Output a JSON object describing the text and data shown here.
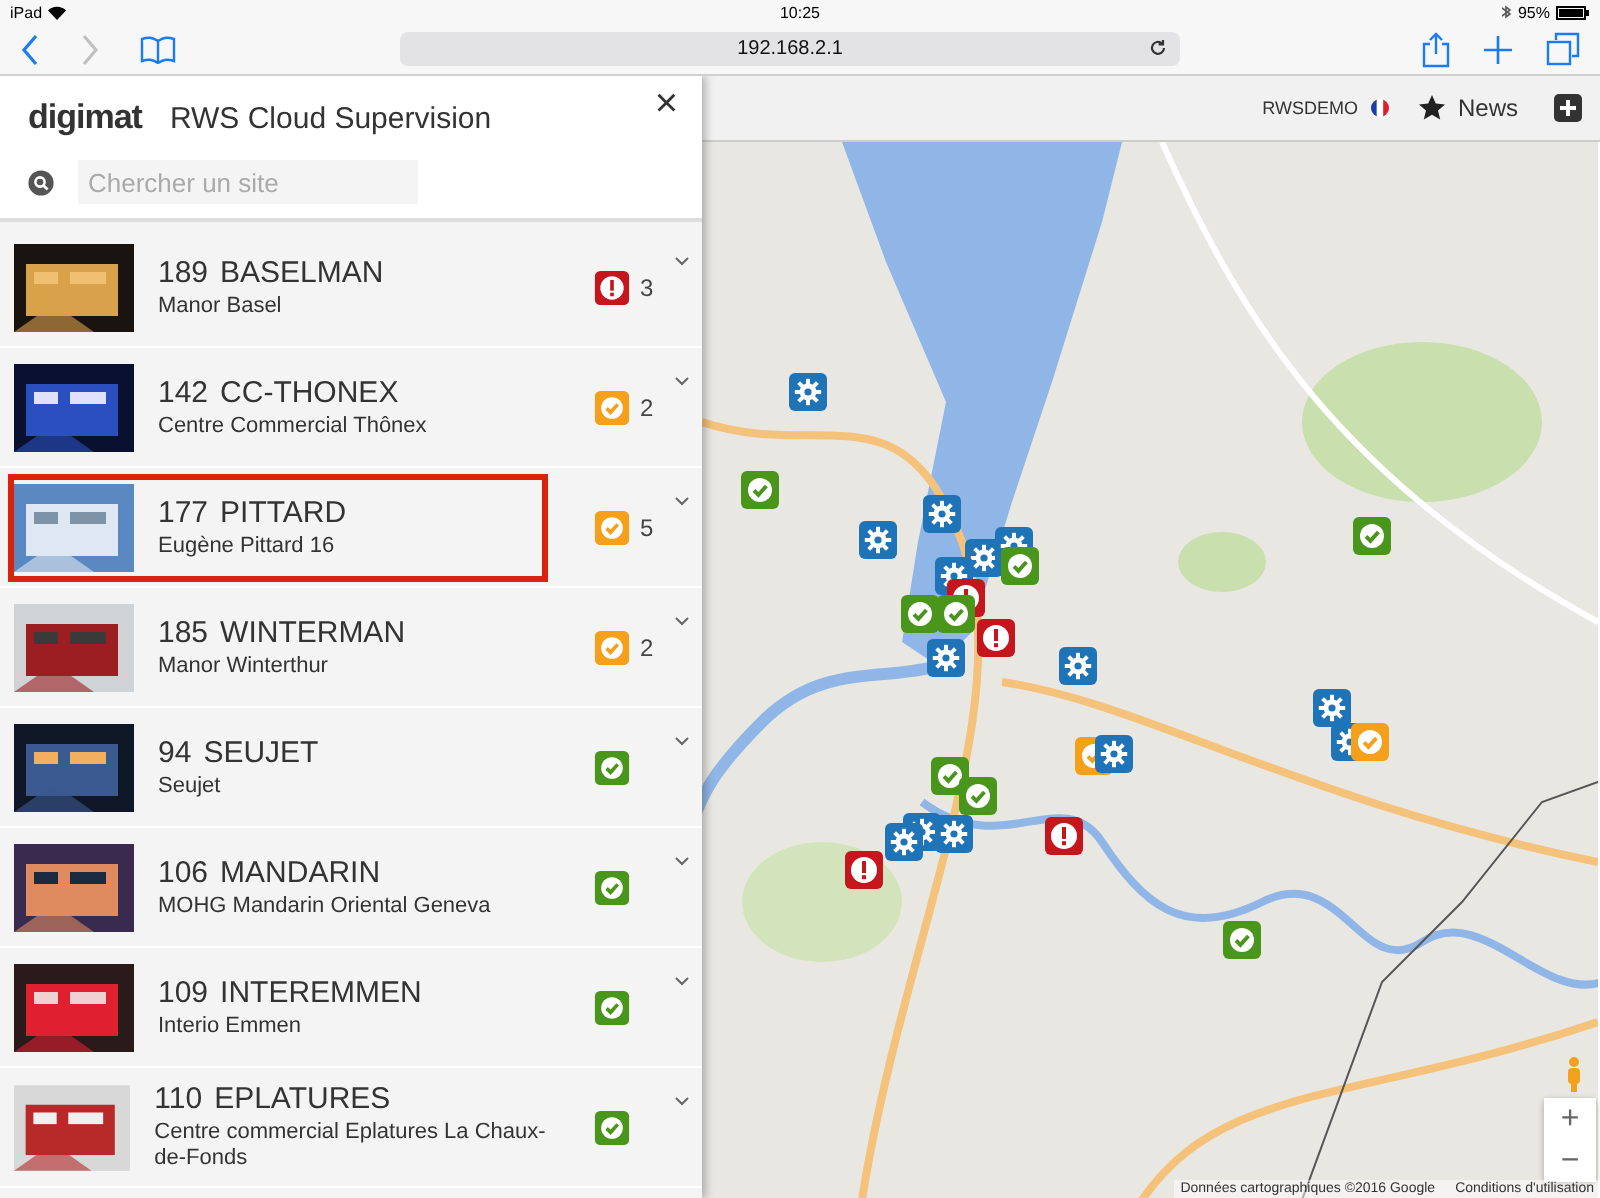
{
  "status_bar": {
    "device": "iPad",
    "time": "10:25",
    "battery": "95%"
  },
  "browser": {
    "address": "192.168.2.1"
  },
  "sidebar": {
    "logo": "digimat",
    "title": "RWS Cloud Supervision",
    "close": "×",
    "search": {
      "placeholder": "Chercher un site"
    },
    "sites": [
      {
        "number": "189",
        "name": "BASELMAN",
        "subtitle": "Manor Basel",
        "kind": "alarm",
        "count": "3",
        "selected": false
      },
      {
        "number": "142",
        "name": "CC-THONEX",
        "subtitle": "Centre Commercial Thônex",
        "kind": "warning",
        "count": "2",
        "selected": false
      },
      {
        "number": "177",
        "name": "PITTARD",
        "subtitle": "Eugène Pittard 16",
        "kind": "warning",
        "count": "5",
        "selected": true
      },
      {
        "number": "185",
        "name": "WINTERMAN",
        "subtitle": "Manor Winterthur",
        "kind": "warning",
        "count": "2",
        "selected": false
      },
      {
        "number": "94",
        "name": "SEUJET",
        "subtitle": "Seujet",
        "kind": "ok",
        "selected": false
      },
      {
        "number": "106",
        "name": "MANDARIN",
        "subtitle": "MOHG Mandarin Oriental Geneva",
        "kind": "ok",
        "selected": false
      },
      {
        "number": "109",
        "name": "INTEREMMEN",
        "subtitle": "Interio Emmen",
        "kind": "ok",
        "selected": false
      },
      {
        "number": "110",
        "name": "EPLATURES",
        "subtitle": "Centre commercial Eplatures La Chaux-de-Fonds",
        "kind": "ok",
        "selected": false
      }
    ]
  },
  "map": {
    "user": "RWSDEMO",
    "news": "News",
    "zoom_in": "+",
    "zoom_out": "−",
    "attribution": "Données cartographiques ©2016 Google",
    "terms": "Conditions d'utilisation",
    "markers": [
      {
        "kind": "gear"
      },
      {
        "kind": "ok"
      },
      {
        "kind": "gear"
      },
      {
        "kind": "gear"
      },
      {
        "kind": "gear"
      },
      {
        "kind": "gear"
      },
      {
        "kind": "ok"
      },
      {
        "kind": "gear"
      },
      {
        "kind": "alarm"
      },
      {
        "kind": "ok"
      },
      {
        "kind": "ok"
      },
      {
        "kind": "alarm"
      },
      {
        "kind": "gear"
      },
      {
        "kind": "gear"
      },
      {
        "kind": "gear"
      },
      {
        "kind": "gear"
      },
      {
        "kind": "warning"
      },
      {
        "kind": "ok"
      },
      {
        "kind": "warning"
      },
      {
        "kind": "gear"
      },
      {
        "kind": "ok"
      },
      {
        "kind": "ok"
      },
      {
        "kind": "gear"
      },
      {
        "kind": "gear"
      },
      {
        "kind": "gear"
      },
      {
        "kind": "alarm"
      },
      {
        "kind": "alarm"
      },
      {
        "kind": "ok"
      }
    ]
  }
}
